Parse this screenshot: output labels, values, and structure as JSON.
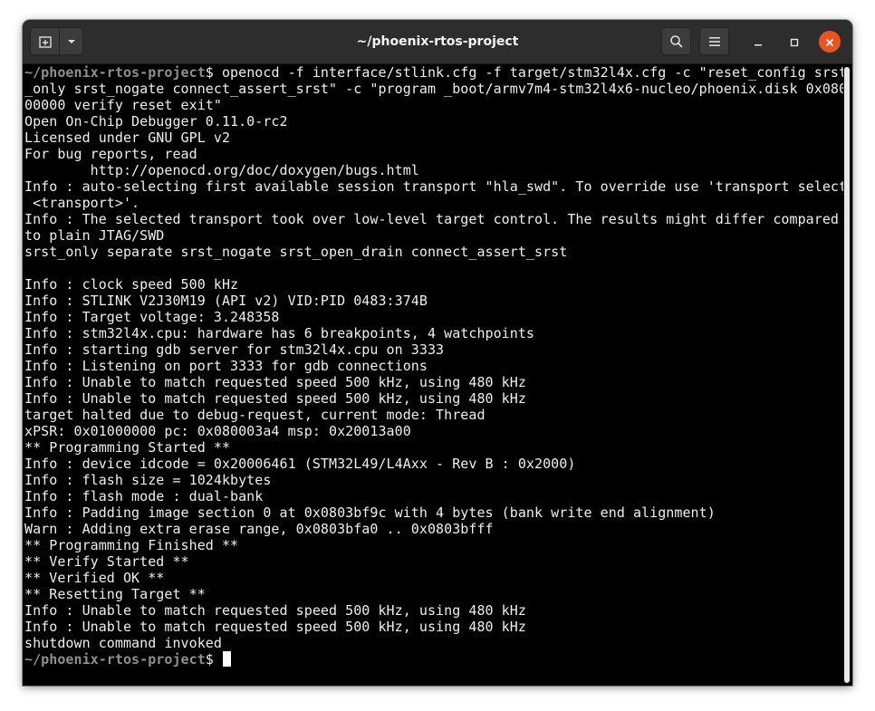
{
  "window": {
    "title": "~/phoenix-rtos-project"
  },
  "titlebar": {
    "new_tab_icon": "new-tab-icon",
    "dropdown_icon": "chevron-down-icon",
    "search_icon": "search-icon",
    "menu_icon": "hamburger-menu-icon",
    "minimize_icon": "minimize-icon",
    "maximize_icon": "maximize-icon",
    "close_icon": "close-icon",
    "close_color": "#e95420"
  },
  "terminal": {
    "prompt_path": "~/phoenix-rtos-project",
    "prompt_symbol": "$ ",
    "command_lines": [
      "openocd -f interface/stlink.cfg -f target/stm32l4x.cfg -c \"reset_config srst",
      "_only srst_nogate connect_assert_srst\" -c \"program _boot/armv7m4-stm32l4x6-nucleo/phoenix.disk 0x080",
      "00000 verify reset exit\""
    ],
    "output_lines": [
      "Open On-Chip Debugger 0.11.0-rc2",
      "Licensed under GNU GPL v2",
      "For bug reports, read",
      "        http://openocd.org/doc/doxygen/bugs.html",
      "Info : auto-selecting first available session transport \"hla_swd\". To override use 'transport select",
      " <transport>'.",
      "Info : The selected transport took over low-level target control. The results might differ compared",
      "to plain JTAG/SWD",
      "srst_only separate srst_nogate srst_open_drain connect_assert_srst",
      "",
      "Info : clock speed 500 kHz",
      "Info : STLINK V2J30M19 (API v2) VID:PID 0483:374B",
      "Info : Target voltage: 3.248358",
      "Info : stm32l4x.cpu: hardware has 6 breakpoints, 4 watchpoints",
      "Info : starting gdb server for stm32l4x.cpu on 3333",
      "Info : Listening on port 3333 for gdb connections",
      "Info : Unable to match requested speed 500 kHz, using 480 kHz",
      "Info : Unable to match requested speed 500 kHz, using 480 kHz",
      "target halted due to debug-request, current mode: Thread",
      "xPSR: 0x01000000 pc: 0x080003a4 msp: 0x20013a00",
      "** Programming Started **",
      "Info : device idcode = 0x20006461 (STM32L49/L4Axx - Rev B : 0x2000)",
      "Info : flash size = 1024kbytes",
      "Info : flash mode : dual-bank",
      "Info : Padding image section 0 at 0x0803bf9c with 4 bytes (bank write end alignment)",
      "Warn : Adding extra erase range, 0x0803bfa0 .. 0x0803bfff",
      "** Programming Finished **",
      "** Verify Started **",
      "** Verified OK **",
      "** Resetting Target **",
      "Info : Unable to match requested speed 500 kHz, using 480 kHz",
      "Info : Unable to match requested speed 500 kHz, using 480 kHz",
      "shutdown command invoked"
    ]
  },
  "colors": {
    "terminal_bg": "#000000",
    "terminal_fg": "#eeeeee",
    "prompt_path": "#8f8f8f",
    "titlebar_bg": "#2d2d2d"
  }
}
